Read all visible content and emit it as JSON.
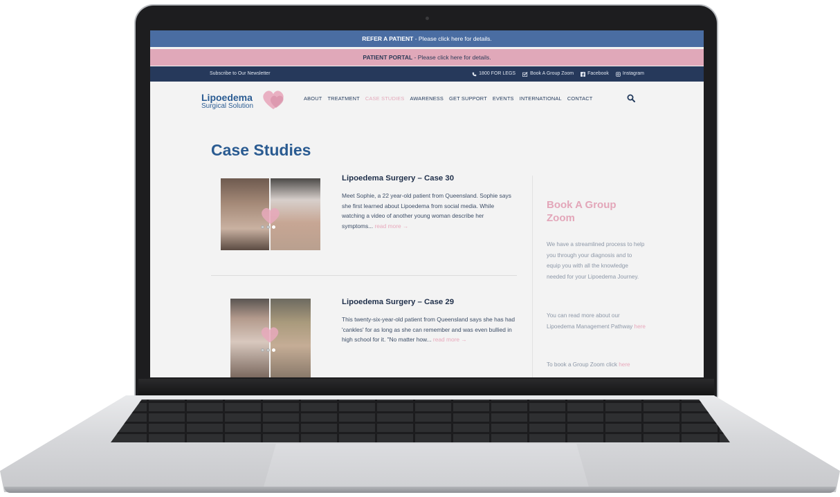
{
  "top_bars": {
    "refer_bold": "REFER A PATIENT",
    "refer_rest": " - Please click here for details.",
    "portal_bold": "PATIENT PORTAL",
    "portal_rest": " - Please click here for details."
  },
  "utility": {
    "newsletter": "Subscribe to Our Newsletter",
    "phone": "1800 FOR LEGS",
    "group_zoom": "Book A Group Zoom",
    "facebook": "Facebook",
    "instagram": "Instagram"
  },
  "logo": {
    "line1": "Lipoedema",
    "line2": "Surgical Solution"
  },
  "nav": {
    "items": [
      "ABOUT",
      "TREATMENT",
      "CASE STUDIES",
      "AWARENESS",
      "GET SUPPORT",
      "EVENTS",
      "INTERNATIONAL",
      "CONTACT"
    ],
    "active": "CASE STUDIES"
  },
  "page": {
    "title": "Case Studies"
  },
  "posts": [
    {
      "title": "Lipoedema Surgery – Case 30",
      "excerpt": "Meet Sophie, a 22 year-old patient from Queensland. Sophie says she first learned about Lipoedema from social media.  While watching a video of another young woman describe her symptoms...",
      "read_more": "read more →"
    },
    {
      "title": "Lipoedema Surgery – Case 29",
      "excerpt": "This twenty-six-year-old patient from Queensland says she has had 'cankles' for as long as she can remember and was even bullied in high school for it.  \"No matter how...",
      "read_more": "read more →"
    }
  ],
  "sidebar": {
    "heading": "Book A Group Zoom",
    "p1": "We have a streamlined process to help you through your diagnosis and to equip you with all the knowledge needed for your Lipoedema Journey.",
    "p2_text": "You can read more about our Lipoedema Management Pathway",
    "p2_link": "here",
    "p3_text": "To book a Group Zoom click",
    "p3_link": "here"
  },
  "colors": {
    "refer_bar": "#4a6da2",
    "portal_bar": "#e0a8b9",
    "utility_bar": "#26395b",
    "brand_blue": "#2a5b91",
    "accent_pink": "#e3a8ba"
  },
  "icons": [
    "phone-icon",
    "group-zoom-icon",
    "facebook-icon",
    "instagram-icon",
    "search-icon",
    "heart-logo-icon"
  ]
}
